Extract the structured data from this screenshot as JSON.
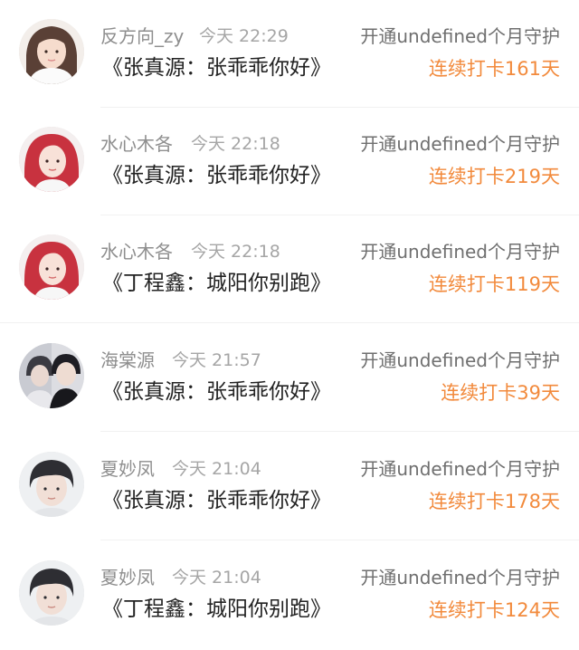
{
  "colors": {
    "streak": "#f28a3c",
    "name": "#8e8e8e",
    "time": "#a6a6a6",
    "title": "#222222",
    "action": "#6f6f6f"
  },
  "items": [
    {
      "name": "反方向_zy",
      "time": "今天 22:29",
      "action": "开通undefined个月守护",
      "title": "《张真源：张乖乖你好》",
      "streak": "连续打卡161天",
      "avatar": "girl-white-top-avatar"
    },
    {
      "name": "水心木各",
      "time": "今天 22:18",
      "action": "开通undefined个月守护",
      "title": "《张真源：张乖乖你好》",
      "streak": "连续打卡219天",
      "avatar": "red-hair-girl-avatar"
    },
    {
      "name": "水心木各",
      "time": "今天 22:18",
      "action": "开通undefined个月守护",
      "title": "《丁程鑫：城阳你别跑》",
      "streak": "连续打卡119天",
      "avatar": "red-hair-girl-avatar"
    },
    {
      "name": "海棠源",
      "time": "今天 21:57",
      "action": "开通undefined个月守护",
      "title": "《张真源：张乖乖你好》",
      "streak": "连续打卡39天",
      "avatar": "two-boys-avatar"
    },
    {
      "name": "夏妙凤",
      "time": "今天 21:04",
      "action": "开通undefined个月守护",
      "title": "《张真源：张乖乖你好》",
      "streak": "连续打卡178天",
      "avatar": "boy-dark-hair-avatar"
    },
    {
      "name": "夏妙凤",
      "time": "今天 21:04",
      "action": "开通undefined个月守护",
      "title": "《丁程鑫：城阳你别跑》",
      "streak": "连续打卡124天",
      "avatar": "boy-dark-hair-avatar"
    }
  ]
}
